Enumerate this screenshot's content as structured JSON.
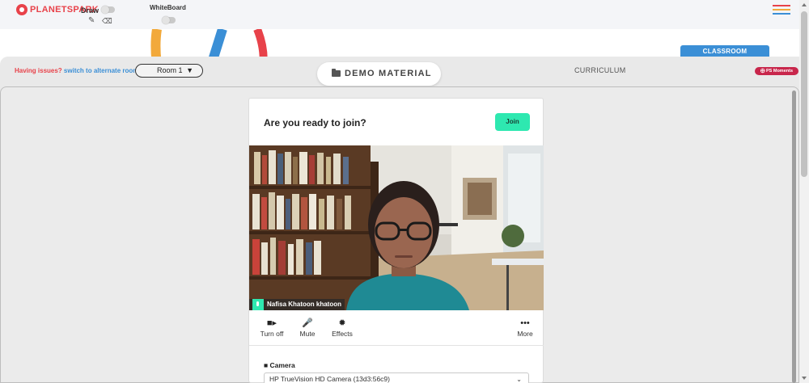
{
  "brand": {
    "logo_text": "PLANETSPARK",
    "logo_color": "#e8424a"
  },
  "toolbar": {
    "draw_label": "Draw",
    "whiteboard_label": "WhiteBoard",
    "pencil_icon": "pencil-icon",
    "eraser_icon": "eraser-icon"
  },
  "tabs": {
    "classroom": "CLASSROOM",
    "demo_material": "DEMO MATERIAL",
    "curriculum": "CURRICULUM"
  },
  "issues": {
    "prefix": "Having issues?",
    "link": "switch to alternate room"
  },
  "room_select": {
    "value": "Room 1"
  },
  "ps_moments": "PS Moments",
  "join_card": {
    "title": "Are you ready to join?",
    "join_label": "Join",
    "participant_name": "Nafisa Khatoon khatoon",
    "controls": [
      {
        "label": "Turn off",
        "icon": "video-camera-icon"
      },
      {
        "label": "Mute",
        "icon": "microphone-icon"
      },
      {
        "label": "Effects",
        "icon": "sparkle-icon"
      },
      {
        "label": "More",
        "icon": "more-dots-icon"
      }
    ],
    "camera_label": "Camera",
    "camera_value": "HP TrueVision HD Camera (13d3:56c9)"
  },
  "colors": {
    "accent_green": "#2ee8b0",
    "brand_blue": "#3b8fd6",
    "brand_red": "#e8424a",
    "moments_red": "#c8264b"
  }
}
